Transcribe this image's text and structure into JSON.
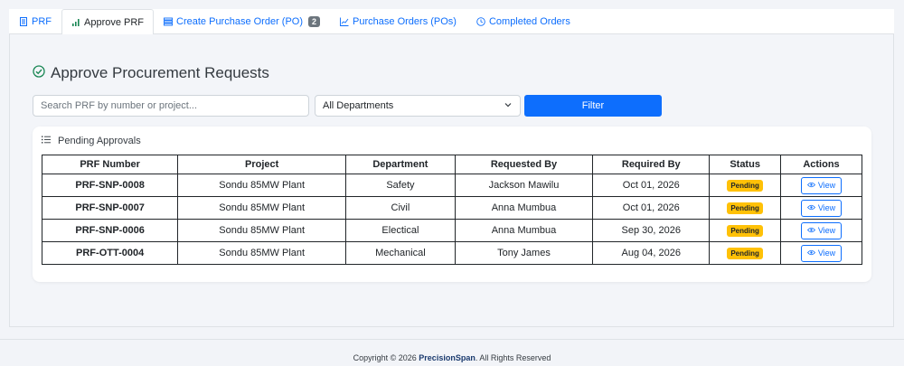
{
  "tabs": [
    {
      "label": "PRF",
      "icon": "document-icon"
    },
    {
      "label": "Approve PRF",
      "icon": "bar-chart-icon",
      "active": true
    },
    {
      "label": "Create Purchase Order (PO)",
      "icon": "list-icon",
      "badge": "2"
    },
    {
      "label": "Purchase Orders (POs)",
      "icon": "line-chart-icon"
    },
    {
      "label": "Completed Orders",
      "icon": "clock-icon"
    }
  ],
  "page": {
    "title": "Approve Procurement Requests"
  },
  "filters": {
    "search_placeholder": "Search PRF by number or project...",
    "department_selected": "All Departments",
    "filter_label": "Filter"
  },
  "card": {
    "title": "Pending Approvals"
  },
  "table": {
    "headers": [
      "PRF Number",
      "Project",
      "Department",
      "Requested By",
      "Required By",
      "Status",
      "Actions"
    ],
    "rows": [
      {
        "prf": "PRF-SNP-0008",
        "project": "Sondu 85MW Plant",
        "department": "Safety",
        "requested_by": "Jackson Mawilu",
        "required_by": "Oct 01, 2026",
        "status": "Pending",
        "action": "View"
      },
      {
        "prf": "PRF-SNP-0007",
        "project": "Sondu 85MW Plant",
        "department": "Civil",
        "requested_by": "Anna Mumbua",
        "required_by": "Oct 01, 2026",
        "status": "Pending",
        "action": "View"
      },
      {
        "prf": "PRF-SNP-0006",
        "project": "Sondu 85MW Plant",
        "department": "Electical",
        "requested_by": "Anna Mumbua",
        "required_by": "Sep 30, 2026",
        "status": "Pending",
        "action": "View"
      },
      {
        "prf": "PRF-OTT-0004",
        "project": "Sondu 85MW Plant",
        "department": "Mechanical",
        "requested_by": "Tony James",
        "required_by": "Aug 04, 2026",
        "status": "Pending",
        "action": "View"
      }
    ]
  },
  "footer": {
    "prefix": "Copyright © 2026 ",
    "brand": "PrecisionSpan",
    "suffix": ". All Rights Reserved"
  },
  "colors": {
    "primary": "#0d6efd",
    "pending": "#ffc107",
    "success_icon": "#198754"
  }
}
